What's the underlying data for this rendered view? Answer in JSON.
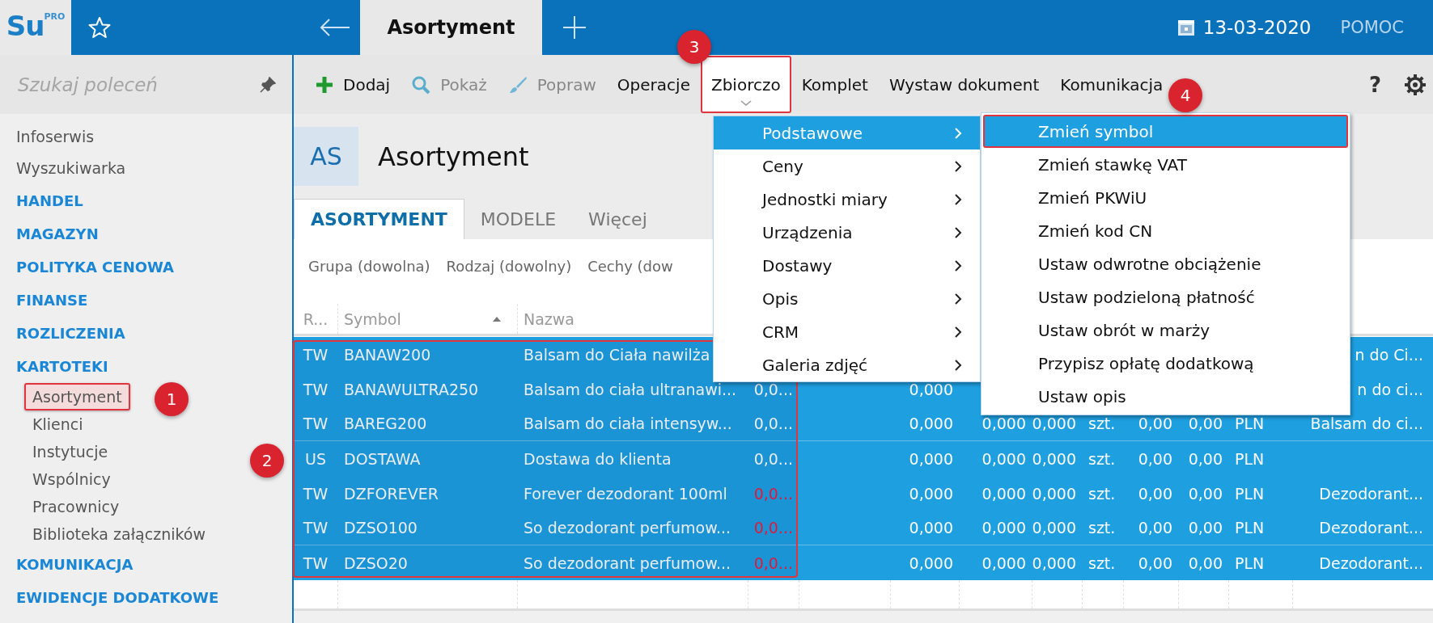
{
  "app": {
    "logo": "Su",
    "logo_sup": "PRO"
  },
  "tabs": [
    {
      "label": "Asortyment",
      "selected": true
    }
  ],
  "date": "13-03-2020",
  "help_link": "POMOC",
  "sidebar": {
    "search_placeholder": "Szukaj poleceń",
    "items": [
      {
        "label": "Infoserwis",
        "kind": "link"
      },
      {
        "label": "Wyszukiwarka",
        "kind": "link"
      },
      {
        "label": "HANDEL",
        "kind": "section"
      },
      {
        "label": "MAGAZYN",
        "kind": "section"
      },
      {
        "label": "POLITYKA CENOWA",
        "kind": "section"
      },
      {
        "label": "FINANSE",
        "kind": "section"
      },
      {
        "label": "ROZLICZENIA",
        "kind": "section"
      },
      {
        "label": "KARTOTEKI",
        "kind": "section",
        "children": [
          {
            "label": "Asortyment",
            "selected": true
          },
          {
            "label": "Klienci",
            "selected": false
          },
          {
            "label": "Instytucje",
            "selected": false
          },
          {
            "label": "Wspólnicy",
            "selected": false
          },
          {
            "label": "Pracownicy",
            "selected": false
          },
          {
            "label": "Biblioteka załączników",
            "selected": false
          }
        ]
      },
      {
        "label": "KOMUNIKACJA",
        "kind": "section"
      },
      {
        "label": "EWIDENCJE DODATKOWE",
        "kind": "section"
      }
    ]
  },
  "toolbar": {
    "buttons": [
      {
        "label": "Dodaj",
        "disabled": false,
        "open": false
      },
      {
        "label": "Pokaż",
        "disabled": true,
        "open": false
      },
      {
        "label": "Popraw",
        "disabled": true,
        "open": false
      },
      {
        "label": "Operacje",
        "disabled": false,
        "open": false
      },
      {
        "label": "Zbiorczo",
        "disabled": false,
        "open": true
      },
      {
        "label": "Komplet",
        "disabled": false,
        "open": false
      },
      {
        "label": "Wystaw dokument",
        "disabled": false,
        "open": false
      },
      {
        "label": "Komunikacja",
        "disabled": false,
        "open": false
      }
    ],
    "help_button": "?"
  },
  "module": {
    "badge": "AS",
    "title": "Asortyment"
  },
  "view_tabs": [
    {
      "label": "ASORTYMENT",
      "selected": true
    },
    {
      "label": "MODELE",
      "selected": false
    },
    {
      "label": "Więcej",
      "selected": false
    }
  ],
  "filters": [
    "Grupa (dowolna)",
    "Rodzaj (dowolny)",
    "Cechy (dow"
  ],
  "table": {
    "columns": [
      {
        "label": "R...",
        "sorted": false
      },
      {
        "label": "Symbol",
        "sorted": true
      },
      {
        "label": "Nazwa",
        "sorted": false
      }
    ],
    "rows": [
      {
        "selected": true,
        "cells": [
          "TW",
          "BANAW200",
          "Balsam do Ciała nawilża",
          null,
          null,
          null,
          null,
          null,
          null,
          null,
          null,
          null,
          "n do Ci..."
        ]
      },
      {
        "selected": true,
        "cells": [
          "TW",
          "BANAWULTRA250",
          "Balsam do ciała ultranawi...",
          {
            "text": "0,0...",
            "warning": false
          },
          null,
          "0,000",
          null,
          null,
          null,
          null,
          null,
          null,
          "n do ci..."
        ]
      },
      {
        "selected": true,
        "cells": [
          "TW",
          "BAREG200",
          "Balsam do ciała intensyw...",
          {
            "text": "0,0...",
            "warning": false
          },
          null,
          "0,000",
          "0,000",
          "0,000",
          "szt.",
          "0,00",
          "0,00",
          "PLN",
          "Balsam do ci..."
        ]
      },
      {
        "selected": true,
        "cells": [
          "US",
          "DOSTAWA",
          "Dostawa do klienta",
          {
            "text": "0,0...",
            "warning": false
          },
          null,
          "0,000",
          "0,000",
          "0,000",
          "szt.",
          "0,00",
          "0,00",
          "PLN",
          null
        ]
      },
      {
        "selected": true,
        "cells": [
          "TW",
          "DZFOREVER",
          "Forever dezodorant 100ml",
          {
            "text": "0,0...",
            "warning": true
          },
          null,
          "0,000",
          "0,000",
          "0,000",
          "szt.",
          "0,00",
          "0,00",
          "PLN",
          "Dezodorant..."
        ]
      },
      {
        "selected": true,
        "cells": [
          "TW",
          "DZSO100",
          "So dezodorant perfumow...",
          {
            "text": "0,0...",
            "warning": true
          },
          null,
          "0,000",
          "0,000",
          "0,000",
          "szt.",
          "0,00",
          "0,00",
          "PLN",
          "Dezodorant..."
        ]
      },
      {
        "selected": true,
        "cells": [
          "TW",
          "DZSO20",
          "So dezodorant perfumow...",
          {
            "text": "0,0...",
            "warning": true
          },
          null,
          "0,000",
          "0,000",
          "0,000",
          "szt.",
          "0,00",
          "0,00",
          "PLN",
          "Dezodorant..."
        ]
      }
    ]
  },
  "menu": {
    "items": [
      {
        "label": "Podstawowe",
        "selected": true
      },
      {
        "label": "Ceny",
        "selected": false
      },
      {
        "label": "Jednostki miary",
        "selected": false
      },
      {
        "label": "Urządzenia",
        "selected": false
      },
      {
        "label": "Dostawy",
        "selected": false
      },
      {
        "label": "Opis",
        "selected": false
      },
      {
        "label": "CRM",
        "selected": false
      },
      {
        "label": "Galeria zdjęć",
        "selected": false
      }
    ],
    "submenu": [
      {
        "label": "Zmień symbol",
        "selected": true
      },
      {
        "label": "Zmień stawkę VAT",
        "selected": false
      },
      {
        "label": "Zmień PKWiU",
        "selected": false
      },
      {
        "label": "Zmień kod CN",
        "selected": false
      },
      {
        "label": "Ustaw odwrotne obciążenie",
        "selected": false
      },
      {
        "label": "Ustaw podzieloną płatność",
        "selected": false
      },
      {
        "label": "Ustaw obrót w marży",
        "selected": false
      },
      {
        "label": "Przypisz opłatę dodatkową",
        "selected": false
      },
      {
        "label": "Ustaw opis",
        "selected": false
      }
    ]
  },
  "annotations": [
    "1",
    "2",
    "3",
    "4"
  ]
}
